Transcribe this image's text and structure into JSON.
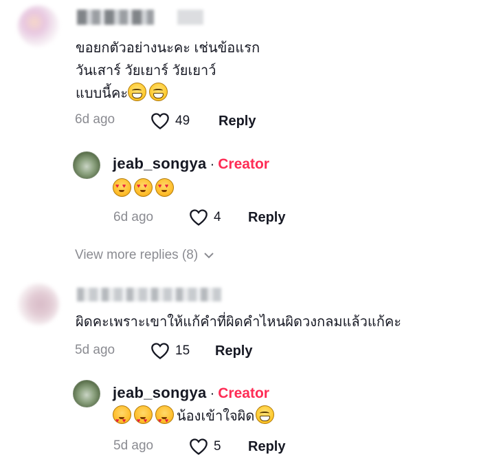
{
  "comments": [
    {
      "text_lines": [
        "ขอยกตัวอย่างนะคะ เช่นข้อแรก",
        "วันเสาร์ วัยเยาร์ วัยเยาว์",
        "แบบนี้คะ"
      ],
      "emoji_count_inline": 2,
      "time": "6d ago",
      "likes": "49",
      "reply_label": "Reply",
      "reply": {
        "username": "jeab_songya",
        "separator": "·",
        "badge": "Creator",
        "text": "",
        "time": "6d ago",
        "likes": "4",
        "reply_label": "Reply"
      },
      "view_more": "View more replies (8)"
    },
    {
      "text_lines": [
        "ผิดคะเพราะเขาให้แก้คำที่ผิดคำไหนผิดวงกลมแล้วแก้คะ"
      ],
      "time": "5d ago",
      "likes": "15",
      "reply_label": "Reply",
      "reply": {
        "username": "jeab_songya",
        "separator": "·",
        "badge": "Creator",
        "text": "น้องเข้าใจผิด",
        "time": "5d ago",
        "likes": "5",
        "reply_label": "Reply"
      }
    }
  ],
  "colors": {
    "creator": "#fe2c55",
    "muted": "#8a8b91",
    "text": "#161823"
  },
  "icons": [
    "heart-icon",
    "chevron-down-icon",
    "grinning-emoji",
    "smiling-hearts-emoji",
    "sweat-smile-emoji"
  ]
}
